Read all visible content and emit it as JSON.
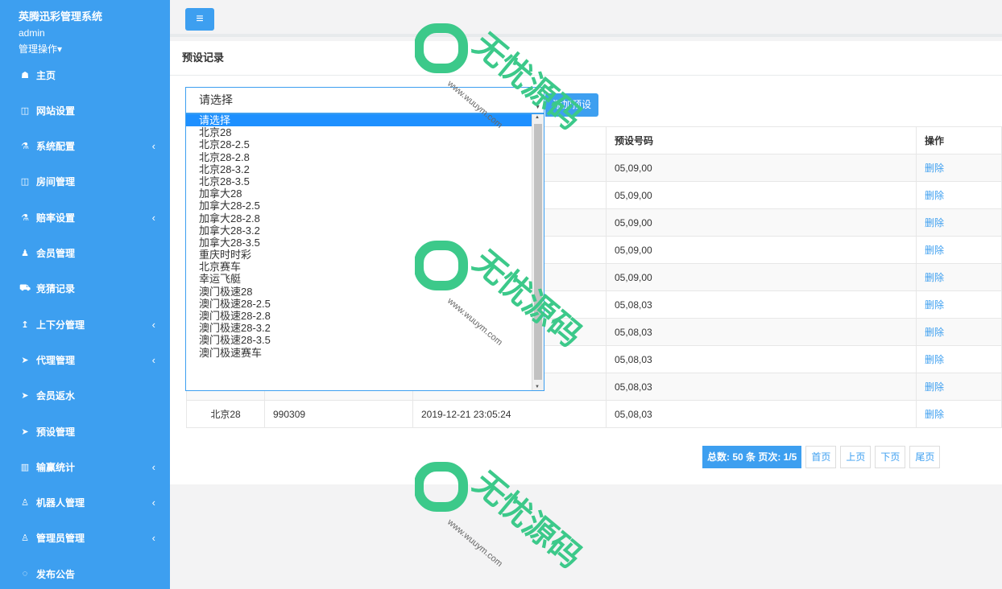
{
  "sidebar": {
    "brand": "英腾迅彩管理系统",
    "user": "admin",
    "ops": "管理操作▾",
    "items": [
      {
        "label": "主页",
        "icon": "home-icon",
        "glyph": "☗",
        "caret": false
      },
      {
        "label": "网站设置",
        "icon": "columns-icon",
        "glyph": "◫",
        "caret": false
      },
      {
        "label": "系统配置",
        "icon": "flask-icon",
        "glyph": "⚗",
        "caret": true
      },
      {
        "label": "房间管理",
        "icon": "columns-icon",
        "glyph": "◫",
        "caret": false
      },
      {
        "label": "赔率设置",
        "icon": "flask-icon",
        "glyph": "⚗",
        "caret": true
      },
      {
        "label": "会员管理",
        "icon": "user-icon",
        "glyph": "♟",
        "caret": false
      },
      {
        "label": "竞猜记录",
        "icon": "car-icon",
        "glyph": "⛟",
        "caret": false
      },
      {
        "label": "上下分管理",
        "icon": "arrow-up-icon",
        "glyph": "↥",
        "caret": true
      },
      {
        "label": "代理管理",
        "icon": "send-icon",
        "glyph": "➤",
        "caret": true
      },
      {
        "label": "会员返水",
        "icon": "send-icon",
        "glyph": "➤",
        "caret": false
      },
      {
        "label": "预设管理",
        "icon": "send-icon",
        "glyph": "➤",
        "caret": false
      },
      {
        "label": "输赢统计",
        "icon": "bar-chart-icon",
        "glyph": "▥",
        "caret": true
      },
      {
        "label": "机器人管理",
        "icon": "male-icon",
        "glyph": "♙",
        "caret": true
      },
      {
        "label": "管理员管理",
        "icon": "male-icon",
        "glyph": "♙",
        "caret": true
      },
      {
        "label": "发布公告",
        "icon": "comment-icon",
        "glyph": "◌",
        "caret": false
      }
    ]
  },
  "page": {
    "title": "预设记录",
    "select_value": "请选择",
    "add_button": "添加预设"
  },
  "dropdown_options": [
    "请选择",
    "北京28",
    "北京28-2.5",
    "北京28-2.8",
    "北京28-3.2",
    "北京28-3.5",
    "加拿大28",
    "加拿大28-2.5",
    "加拿大28-2.8",
    "加拿大28-3.2",
    "加拿大28-3.5",
    "重庆时时彩",
    "北京赛车",
    "幸运飞艇",
    "澳门极速28",
    "澳门极速28-2.5",
    "澳门极速28-2.8",
    "澳门极速28-3.2",
    "澳门极速28-3.5",
    "澳门极速赛车"
  ],
  "table": {
    "headers": [
      "",
      "",
      "",
      "预设号码",
      "操作"
    ],
    "rows": [
      [
        "",
        "",
        "",
        "05,09,00",
        "删除"
      ],
      [
        "",
        "",
        "",
        "05,09,00",
        "删除"
      ],
      [
        "",
        "",
        "",
        "05,09,00",
        "删除"
      ],
      [
        "",
        "",
        "",
        "05,09,00",
        "删除"
      ],
      [
        "",
        "",
        "",
        "05,09,00",
        "删除"
      ],
      [
        "",
        "",
        "",
        "05,08,03",
        "删除"
      ],
      [
        "",
        "",
        "",
        "05,08,03",
        "删除"
      ],
      [
        "",
        "",
        "",
        "05,08,03",
        "删除"
      ],
      [
        "",
        "",
        "",
        "05,08,03",
        "删除"
      ],
      [
        "北京28",
        "990309",
        "2019-12-21 23:05:24",
        "05,08,03",
        "删除"
      ]
    ]
  },
  "pager": {
    "total": "总数: 50 条 页次: 1/5",
    "first": "首页",
    "prev": "上页",
    "next": "下页",
    "last": "尾页"
  },
  "watermark": {
    "text": "无忧源码",
    "url": "www.wuuym.com",
    "color": "#3cc98a"
  }
}
